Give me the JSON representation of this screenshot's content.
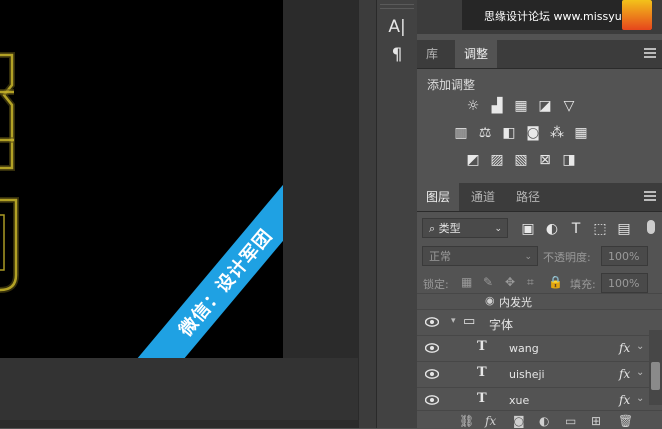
{
  "canvas": {
    "ribbon_text": "微信：设计军团"
  },
  "tools": {
    "text_tool_glyph": "A|",
    "paragraph_glyph": "¶"
  },
  "navigator": {
    "watermark": "思缘设计论坛 www.missyuan.com"
  },
  "top_tabs": [
    {
      "label": "库",
      "active": false
    },
    {
      "label": "调整",
      "active": true
    }
  ],
  "adjustments": {
    "title": "添加调整",
    "row1": [
      "brightness-icon",
      "levels-icon",
      "curves-icon",
      "exposure-icon",
      "vibrance-icon"
    ],
    "row2": [
      "hue-saturation-icon",
      "color-balance-icon",
      "black-white-icon",
      "photo-filter-icon",
      "channel-mixer-icon",
      "color-lookup-icon"
    ],
    "row3": [
      "invert-icon",
      "posterize-icon",
      "threshold-icon",
      "selective-color-icon",
      "gradient-map-icon"
    ]
  },
  "layer_tabs": [
    {
      "label": "图层",
      "active": true
    },
    {
      "label": "通道",
      "active": false
    },
    {
      "label": "路径",
      "active": false
    }
  ],
  "layers_panel": {
    "filter_kind": "类型",
    "blend_mode": "正常",
    "opacity_label": "不透明度:",
    "opacity_value": "100%",
    "lock_label": "锁定:",
    "fill_label": "填充:",
    "fill_value": "100%",
    "partial_layer": "内发光",
    "group_name": "字体",
    "layers": [
      {
        "name": "wang",
        "fx": "fx"
      },
      {
        "name": "uisheji",
        "fx": "fx"
      },
      {
        "name": "xue",
        "fx": "fx"
      }
    ],
    "footer_icons": [
      "link-icon",
      "fx-icon",
      "mask-icon",
      "adjustment-layer-icon",
      "group-folder-icon",
      "new-layer-icon",
      "trash-icon"
    ]
  }
}
